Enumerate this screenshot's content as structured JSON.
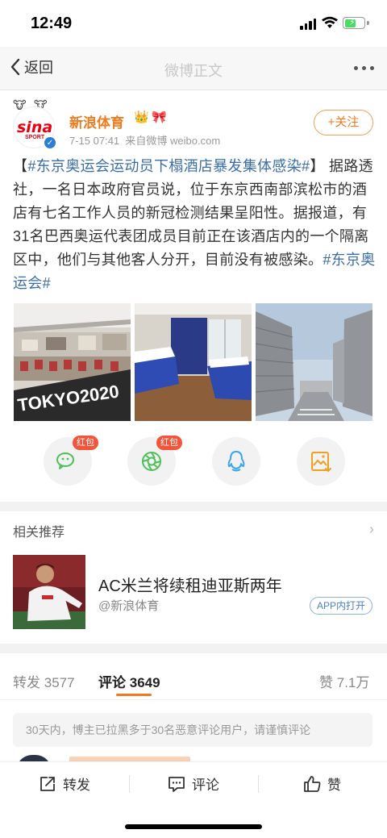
{
  "status_bar": {
    "time": "12:49"
  },
  "nav": {
    "back_label": "返回",
    "title": "微博正文"
  },
  "post": {
    "author": "新浪体育",
    "avatar_text": "sina",
    "avatar_sub": "SPORT",
    "time": "7-15 07:41",
    "source": "来自微博 weibo.com",
    "follow_label": "+关注",
    "text": {
      "bracket_open": "【",
      "hashtag_title": "#东京奥运会运动员下榻酒店暴发集体感染#",
      "bracket_close": "】",
      "body": "据路透社，一名日本政府官员说，位于东京西南部滨松市的酒店有七名工作人员的新冠检测结果呈阳性。据报道，有31名巴西奥运代表团成员目前正在该酒店内的一个隔离区中，他们与其他客人分开，目前没有被感染。",
      "hashtag_end": "#东京奥运会#"
    },
    "image1_text": "TOKYO2020"
  },
  "share": {
    "hongbao_label": "红包",
    "icons": [
      "wechat-icon",
      "moments-icon",
      "qq-icon",
      "save-image-icon"
    ]
  },
  "related": {
    "title": "相关推荐",
    "card_title": "AC米兰将续租迪亚斯两年",
    "card_source": "@新浪体育",
    "app_open_label": "APP内打开"
  },
  "tabs": {
    "repost_label": "转发",
    "repost_count": "3577",
    "comment_label": "评论",
    "comment_count": "3649",
    "like_label": "赞",
    "like_count": "7.1万"
  },
  "notice": "30天内，博主已拉黑多于30名恶意评论用户，请谨慎评论",
  "bottom_bar": {
    "repost": "转发",
    "comment": "评论",
    "like": "赞"
  },
  "colors": {
    "accent": "#f07b1f",
    "link": "#3b6ea8",
    "hongbao": "#f4553a"
  }
}
